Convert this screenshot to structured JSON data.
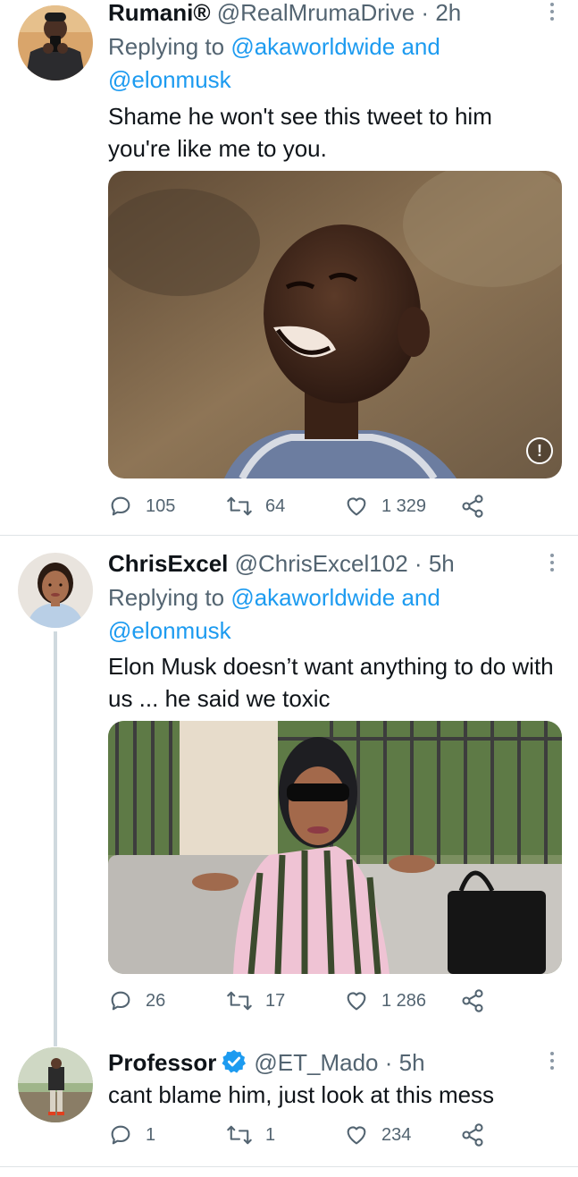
{
  "tweets": [
    {
      "name": "Rumani®",
      "handle": "@RealMrumaDrive",
      "dot": "·",
      "time": "2h",
      "replying_prefix": "Replying to",
      "mention1": "@akaworldwide",
      "and": "and",
      "mention2": "@elonmusk",
      "text": "Shame he won't see this tweet to him you're like me to you.",
      "replies": "105",
      "retweets": "64",
      "likes": "1 329"
    },
    {
      "name": "ChrisExcel",
      "handle": "@ChrisExcel102",
      "dot": "·",
      "time": "5h",
      "replying_prefix": "Replying to",
      "mention1": "@akaworldwide",
      "and": "and",
      "mention2": "@elonmusk",
      "text": "Elon Musk doesn’t want anything to do with us ... he said we toxic",
      "replies": "26",
      "retweets": "17",
      "likes": "1 286"
    },
    {
      "name": "Professor",
      "handle": "@ET_Mado",
      "dot": "·",
      "time": "5h",
      "text": "cant blame him, just look at this mess",
      "replies": "1",
      "retweets": "1",
      "likes": "234"
    }
  ],
  "media_alert": "!",
  "colors": {
    "link": "#1d9bf0",
    "secondary": "#536471",
    "divider": "#dfe3e6",
    "thread_line": "#cfd9de"
  }
}
